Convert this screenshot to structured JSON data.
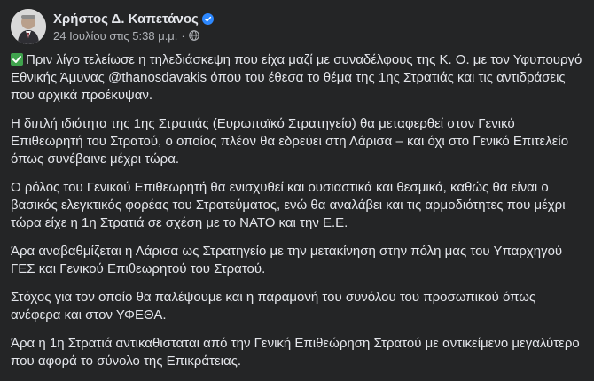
{
  "author": {
    "name": "Χρήστος Δ. Καπετάνος",
    "avatar_icon": "profile-photo",
    "verified_icon": "verified-badge-icon"
  },
  "post_meta": {
    "timestamp": "24 Ιουλίου στις 5:38 μ.μ.",
    "separator": "·",
    "audience_icon": "globe-icon"
  },
  "paragraphs": [
    "Πριν λίγο τελείωσε η τηλεδιάσκεψη που είχα μαζί με συναδέλφους της Κ. Ο. με τον Υφυπουργό Εθνικής Άμυνας @thanosdavakis όπου του έθεσα το θέμα της 1ης Στρατιάς και τις αντιδράσεις που αρχικά προέκυψαν.",
    "Η διπλή ιδιότητα της 1ης Στρατιάς (Ευρωπαϊκό Στρατηγείο) θα μεταφερθεί στον Γενικό Επιθεωρητή του Στρατού, ο οποίος πλέον θα εδρεύει στη Λάρισα – και όχι στο Γενικό Επιτελείο όπως συνέβαινε μέχρι τώρα.",
    "Ο ρόλος του Γενικού Επιθεωρητή θα ενισχυθεί και ουσιαστικά και θεσμικά, καθώς θα είναι ο βασικός ελεγκτικός φορέας του Στρατεύματος, ενώ θα αναλάβει και τις αρμοδιότητες που μέχρι τώρα είχε η 1η Στρατιά σε σχέση με το ΝΑΤΟ και την Ε.Ε.",
    "Άρα αναβαθμίζεται η Λάρισα ως Στρατηγείο με την μετακίνηση στην πόλη μας του Υπαρχηγού ΓΕΣ και Γενικού Επιθεωρητού του Στρατού.",
    "Στόχος για τον οποίο θα παλέψουμε και η παραμονή του συνόλου του προσωπικού όπως ανέφερα και στον ΥΦΕΘΑ.",
    "Άρα η 1η Στρατιά αντικαθισταται από την Γενική Επιθεώρηση Στρατού με αντικείμενο μεγαλύτερο που αφορά το σύνολο της Επικράτειας."
  ],
  "first_paragraph_icon": "check-mark-emoji-icon"
}
